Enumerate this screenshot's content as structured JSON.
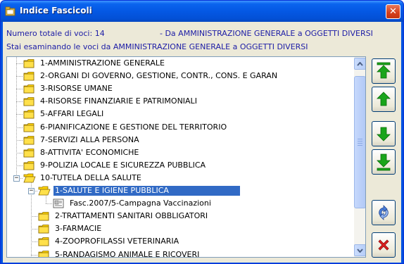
{
  "window": {
    "title": "Indice Fascicoli",
    "close_glyph": "✕"
  },
  "info": {
    "total_label": "Numero totale di voci: 14",
    "range_label": "- Da AMMINISTRAZIONE GENERALE a OGGETTI DIVERSI",
    "examining_label": "Stai esaminando le voci da AMMINISTRAZIONE GENERALE a OGGETTI DIVERSI"
  },
  "tree": {
    "items": [
      {
        "label": "1-AMMINISTRAZIONE GENERALE",
        "icon": "folder-closed-icon"
      },
      {
        "label": "2-ORGANI DI GOVERNO, GESTIONE, CONTR., CONS. E GARAN",
        "icon": "folder-closed-icon"
      },
      {
        "label": "3-RISORSE UMANE",
        "icon": "folder-closed-icon"
      },
      {
        "label": "4-RISORSE FINANZIARIE E PATRIMONIALI",
        "icon": "folder-closed-icon"
      },
      {
        "label": "5-AFFARI LEGALI",
        "icon": "folder-closed-icon"
      },
      {
        "label": "6-PIANIFICAZIONE E GESTIONE DEL TERRITORIO",
        "icon": "folder-closed-icon"
      },
      {
        "label": "7-SERVIZI ALLA PERSONA",
        "icon": "folder-closed-icon"
      },
      {
        "label": "8-ATTIVITA' ECONOMICHE",
        "icon": "folder-closed-icon"
      },
      {
        "label": "9-POLIZIA LOCALE E SICUREZZA PUBBLICA",
        "icon": "folder-closed-icon"
      },
      {
        "label": "10-TUTELA DELLA SALUTE",
        "icon": "folder-open-icon",
        "expanded": true
      },
      {
        "label": "1-SALUTE E IGIENE PUBBLICA",
        "icon": "folder-open-icon",
        "expanded": true,
        "selected": true
      },
      {
        "label": "Fasc.2007/5-Campagna Vaccinazioni",
        "icon": "document-icon"
      },
      {
        "label": "2-TRATTAMENTI SANITARI OBBLIGATORI",
        "icon": "folder-closed-icon"
      },
      {
        "label": "3-FARMACIE",
        "icon": "folder-closed-icon"
      },
      {
        "label": "4-ZOOPROFILASSI VETERINARIA",
        "icon": "folder-closed-icon"
      },
      {
        "label": "5-RANDAGISMO ANIMALE E RICOVERI",
        "icon": "folder-closed-icon"
      }
    ],
    "expander_minus": "−"
  },
  "side_buttons": [
    {
      "icon": "arrow-up-top-icon"
    },
    {
      "icon": "arrow-up-icon"
    },
    {
      "icon": "arrow-down-icon"
    },
    {
      "icon": "arrow-down-bottom-icon"
    },
    {
      "icon": "refresh-icon"
    },
    {
      "icon": "delete-icon"
    }
  ],
  "colors": {
    "title_bar": "#0458e4",
    "selection": "#316ac5",
    "info_text": "#1c1ca6",
    "folder": "#ffd400",
    "arrow_green": "#1aa51a",
    "delete_red": "#e02020"
  }
}
